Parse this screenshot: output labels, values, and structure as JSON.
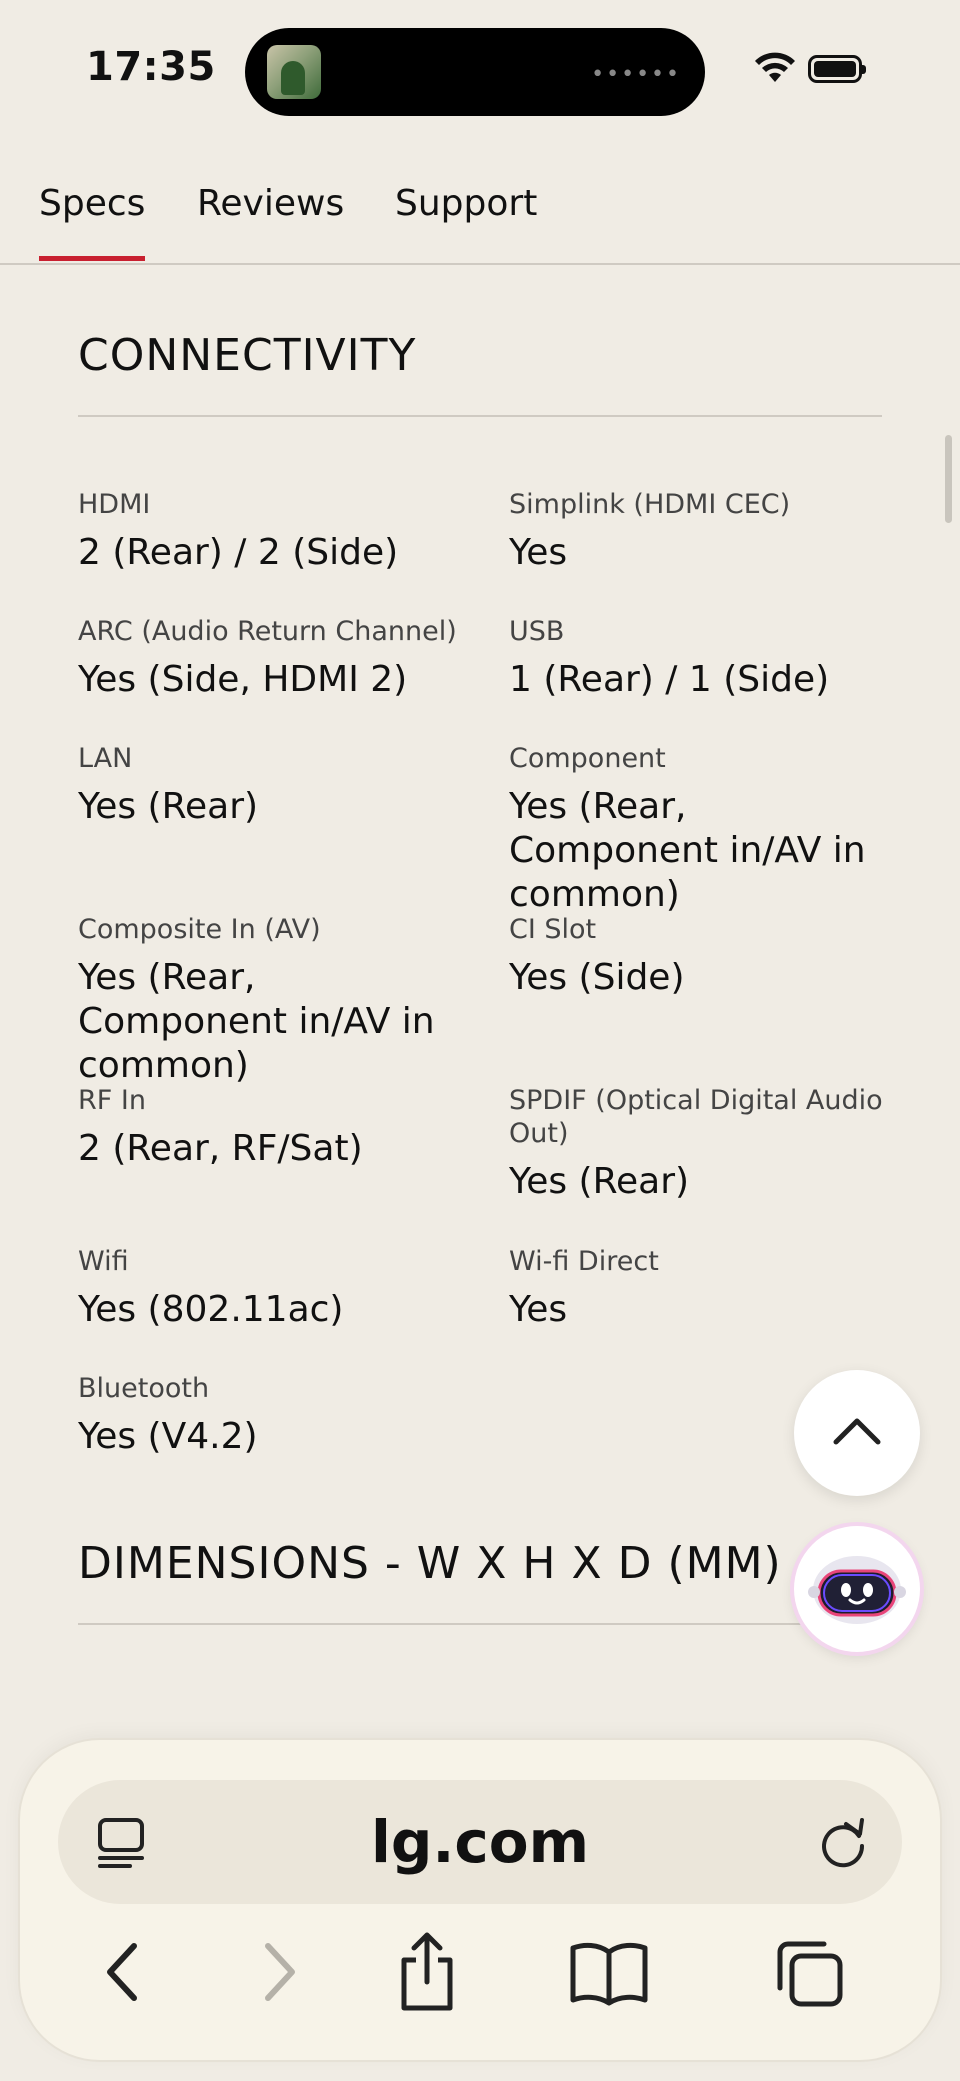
{
  "status_bar": {
    "time": "17:35"
  },
  "tabs": [
    "Specs",
    "Reviews",
    "Support"
  ],
  "connectivity": {
    "title": "CONNECTIVITY",
    "specs": [
      {
        "label": "HDMI",
        "value": "2 (Rear) / 2 (Side)"
      },
      {
        "label": "Simplink (HDMI CEC)",
        "value": "Yes"
      },
      {
        "label": "ARC (Audio Return Channel)",
        "value": "Yes (Side, HDMI 2)"
      },
      {
        "label": "USB",
        "value": "1 (Rear) / 1 (Side)"
      },
      {
        "label": "LAN",
        "value": "Yes (Rear)"
      },
      {
        "label": "Component",
        "value": "Yes (Rear, Component in/AV in common)"
      },
      {
        "label": "Composite In (AV)",
        "value": "Yes (Rear, Component in/AV in common)"
      },
      {
        "label": "CI Slot",
        "value": "Yes (Side)"
      },
      {
        "label": "RF In",
        "value": "2 (Rear, RF/Sat)"
      },
      {
        "label": "SPDIF (Optical Digital Audio Out)",
        "value": "Yes (Rear)"
      },
      {
        "label": "Wifi",
        "value": "Yes (802.11ac)"
      },
      {
        "label": "Wi-fi Direct",
        "value": "Yes"
      },
      {
        "label": "Bluetooth",
        "value": "Yes (V4.2)"
      }
    ]
  },
  "dimensions": {
    "title": "DIMENSIONS - W X H X D (MM)"
  },
  "browser": {
    "url": "lg.com"
  },
  "icons": {
    "album": "album-art-icon",
    "wifi": "wifi-icon",
    "battery": "battery-icon",
    "scroll_top": "chevron-up-icon",
    "chatbot": "chatbot-icon",
    "reader": "reader-icon",
    "reload": "reload-icon",
    "back": "back-icon",
    "forward": "forward-icon",
    "share": "share-icon",
    "bookmarks": "bookmarks-icon",
    "tabs": "tabs-icon"
  },
  "colors": {
    "accent": "#c8202f",
    "background": "#f0ece4"
  }
}
